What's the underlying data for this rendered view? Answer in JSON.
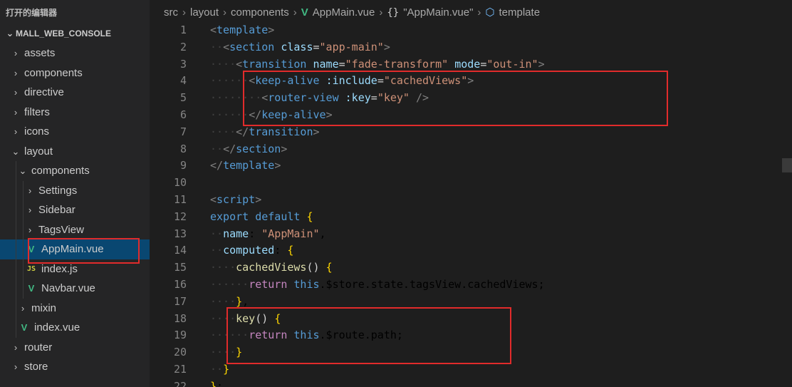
{
  "sidebar": {
    "header": "打开的编辑器",
    "section": "MALL_WEB_CONSOLE",
    "items": [
      {
        "label": "assets",
        "type": "folder"
      },
      {
        "label": "components",
        "type": "folder"
      },
      {
        "label": "directive",
        "type": "folder"
      },
      {
        "label": "filters",
        "type": "folder"
      },
      {
        "label": "icons",
        "type": "folder"
      },
      {
        "label": "layout",
        "type": "folder-open"
      },
      {
        "label": "components",
        "type": "folder-open"
      },
      {
        "label": "Settings",
        "type": "folder"
      },
      {
        "label": "Sidebar",
        "type": "folder"
      },
      {
        "label": "TagsView",
        "type": "folder"
      },
      {
        "label": "AppMain.vue",
        "type": "vue",
        "selected": true
      },
      {
        "label": "index.js",
        "type": "js"
      },
      {
        "label": "Navbar.vue",
        "type": "vue"
      },
      {
        "label": "mixin",
        "type": "folder"
      },
      {
        "label": "index.vue",
        "type": "vue"
      },
      {
        "label": "router",
        "type": "folder"
      },
      {
        "label": "store",
        "type": "folder"
      }
    ]
  },
  "breadcrumb": {
    "src": "src",
    "layout": "layout",
    "components": "components",
    "file": "AppMain.vue",
    "braces": "{}",
    "symbol": "\"AppMain.vue\"",
    "template": "template"
  },
  "icons": {
    "chevron_right": "chevron-right-icon",
    "chevron_down": "chevron-down-icon",
    "vue": "vue-file-icon",
    "js": "js-file-icon",
    "cube": "symbol-cube-icon"
  },
  "code_lines": [
    {
      "n": "1",
      "text": "<template>"
    },
    {
      "n": "2",
      "text": "  <section class=\"app-main\">"
    },
    {
      "n": "3",
      "text": "    <transition name=\"fade-transform\" mode=\"out-in\">"
    },
    {
      "n": "4",
      "text": "      <keep-alive :include=\"cachedViews\">"
    },
    {
      "n": "5",
      "text": "        <router-view :key=\"key\" />"
    },
    {
      "n": "6",
      "text": "      </keep-alive>"
    },
    {
      "n": "7",
      "text": "    </transition>"
    },
    {
      "n": "8",
      "text": "  </section>"
    },
    {
      "n": "9",
      "text": "</template>"
    },
    {
      "n": "10",
      "text": ""
    },
    {
      "n": "11",
      "text": "<script>"
    },
    {
      "n": "12",
      "text": "export default {"
    },
    {
      "n": "13",
      "text": "  name: \"AppMain\","
    },
    {
      "n": "14",
      "text": "  computed: {"
    },
    {
      "n": "15",
      "text": "    cachedViews() {"
    },
    {
      "n": "16",
      "text": "      return this.$store.state.tagsView.cachedViews;"
    },
    {
      "n": "17",
      "text": "    },"
    },
    {
      "n": "18",
      "text": "    key() {"
    },
    {
      "n": "19",
      "text": "      return this.$route.path;"
    },
    {
      "n": "20",
      "text": "    }"
    },
    {
      "n": "21",
      "text": "  }"
    },
    {
      "n": "22",
      "text": "};"
    }
  ],
  "colors": {
    "highlight_box": "#e12b2b",
    "selection": "#094771",
    "vue_green": "#41b883",
    "js_yellow": "#cbcb41"
  }
}
